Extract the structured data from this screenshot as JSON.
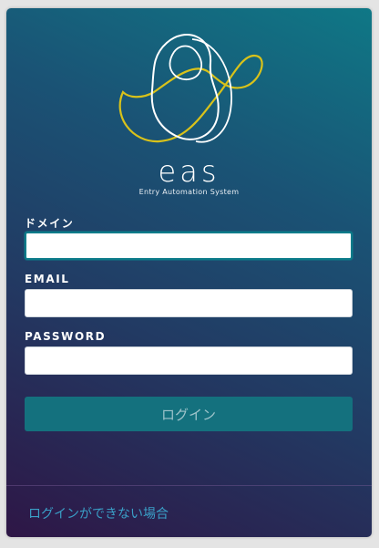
{
  "logo": {
    "wordmark": "eas",
    "tagline": "Entry Automation System",
    "colors": {
      "loop_white": "#ffffff",
      "loop_yellow": "#d9c21a"
    }
  },
  "form": {
    "domain_label": "ドメイン",
    "domain_value": "",
    "email_label": "EMAIL",
    "email_value": "",
    "password_label": "PASSWORD",
    "password_value": "",
    "login_button": "ログイン"
  },
  "footer": {
    "help_link": "ログインができない場合"
  },
  "colors": {
    "accent": "#14717e",
    "link": "#3a9fc7",
    "gradient_top": "#0f7886",
    "gradient_bottom": "#2e1646"
  }
}
